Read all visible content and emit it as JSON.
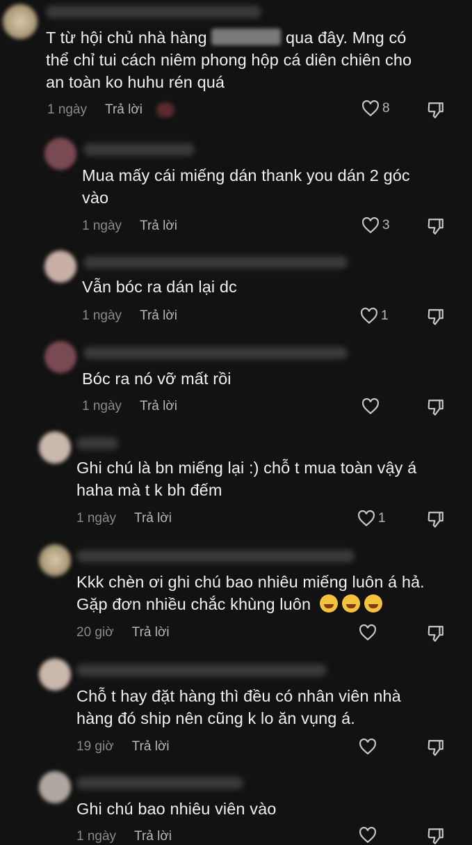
{
  "comments": [
    {
      "text_line1_pre": "T từ hội chủ nhà hàng",
      "text_line1_post": "qua đây. Mng có",
      "text_line2": "thể chỉ tui cách niêm phong hộp cá diên chiên cho",
      "text_line3": "an toàn ko huhu rén quá",
      "time": "1 ngày",
      "reply": "Trả lời",
      "likes": "8"
    },
    {
      "line1": "Mua mấy cái miếng dán thank you dán 2 góc",
      "line2": "vào",
      "time": "1 ngày",
      "reply": "Trả lời",
      "likes": "3"
    },
    {
      "line1": "Vẫn bóc ra dán lại dc",
      "time": "1 ngày",
      "reply": "Trả lời",
      "likes": "1"
    },
    {
      "line1": "Bóc ra nó vỡ mất rồi",
      "time": "1 ngày",
      "reply": "Trả lời",
      "likes": ""
    },
    {
      "line1": "Ghi chú là bn miếng lại :) chỗ t mua toàn vậy á",
      "line2": "haha mà t k bh đếm",
      "time": "1 ngày",
      "reply": "Trả lời",
      "likes": "1"
    },
    {
      "line1": "Kkk chèn ơi ghi chú bao nhiêu miếng luôn á hả.",
      "line2": "Gặp đơn nhiều chắc khùng luôn",
      "time": "20 giờ",
      "reply": "Trả lời",
      "likes": ""
    },
    {
      "line1": "Chỗ t hay đặt hàng thì đều có nhân viên nhà",
      "line2": "hàng đó ship nên cũng k lo ăn vụng á.",
      "time": "19 giờ",
      "reply": "Trả lời",
      "likes": ""
    },
    {
      "line1": "Ghi chú bao nhiêu viên vào",
      "time": "1 ngày",
      "reply": "Trả lời",
      "likes": ""
    }
  ],
  "colors": {
    "background": "#121212",
    "text": "#f1f1f1",
    "meta": "#8a8a8a"
  },
  "icons": [
    "heart-icon",
    "dislike-icon",
    "avatar"
  ]
}
